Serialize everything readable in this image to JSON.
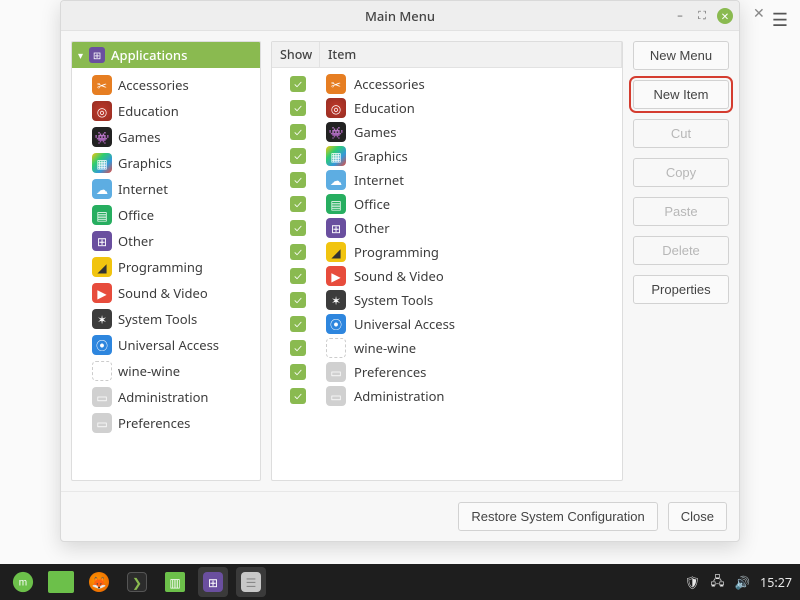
{
  "window": {
    "title": "Main Menu"
  },
  "tree": {
    "root_label": "Applications",
    "items": [
      {
        "label": "Accessories",
        "icon": "accessories"
      },
      {
        "label": "Education",
        "icon": "education"
      },
      {
        "label": "Games",
        "icon": "games"
      },
      {
        "label": "Graphics",
        "icon": "graphics"
      },
      {
        "label": "Internet",
        "icon": "internet"
      },
      {
        "label": "Office",
        "icon": "office"
      },
      {
        "label": "Other",
        "icon": "other"
      },
      {
        "label": "Programming",
        "icon": "programming"
      },
      {
        "label": "Sound & Video",
        "icon": "soundvideo"
      },
      {
        "label": "System Tools",
        "icon": "systemtools"
      },
      {
        "label": "Universal Access",
        "icon": "universal"
      },
      {
        "label": "wine-wine",
        "icon": "wine"
      },
      {
        "label": "Administration",
        "icon": "admin"
      },
      {
        "label": "Preferences",
        "icon": "prefs"
      }
    ]
  },
  "list": {
    "header_show": "Show",
    "header_item": "Item",
    "rows": [
      {
        "label": "Accessories",
        "icon": "accessories",
        "checked": true
      },
      {
        "label": "Education",
        "icon": "education",
        "checked": true
      },
      {
        "label": "Games",
        "icon": "games",
        "checked": true
      },
      {
        "label": "Graphics",
        "icon": "graphics",
        "checked": true
      },
      {
        "label": "Internet",
        "icon": "internet",
        "checked": true
      },
      {
        "label": "Office",
        "icon": "office",
        "checked": true
      },
      {
        "label": "Other",
        "icon": "other",
        "checked": true
      },
      {
        "label": "Programming",
        "icon": "programming",
        "checked": true
      },
      {
        "label": "Sound & Video",
        "icon": "soundvideo",
        "checked": true
      },
      {
        "label": "System Tools",
        "icon": "systemtools",
        "checked": true
      },
      {
        "label": "Universal Access",
        "icon": "universal",
        "checked": true
      },
      {
        "label": "wine-wine",
        "icon": "wine",
        "checked": true
      },
      {
        "label": "Preferences",
        "icon": "prefs",
        "checked": true
      },
      {
        "label": "Administration",
        "icon": "admin",
        "checked": true
      }
    ]
  },
  "buttons": {
    "new_menu": "New Menu",
    "new_item": "New Item",
    "cut": "Cut",
    "copy": "Copy",
    "paste": "Paste",
    "delete": "Delete",
    "properties": "Properties",
    "restore": "Restore System Configuration",
    "close": "Close"
  },
  "panel": {
    "time": "15:27"
  },
  "icon_glyphs": {
    "apps": "⊞",
    "accessories": "✂",
    "education": "◎",
    "games": "👾",
    "graphics": "▦",
    "internet": "☁",
    "office": "▤",
    "other": "⊞",
    "programming": "◢",
    "soundvideo": "▶",
    "systemtools": "✶",
    "universal": "⦿",
    "wine": "",
    "admin": "▭",
    "prefs": "▭"
  }
}
